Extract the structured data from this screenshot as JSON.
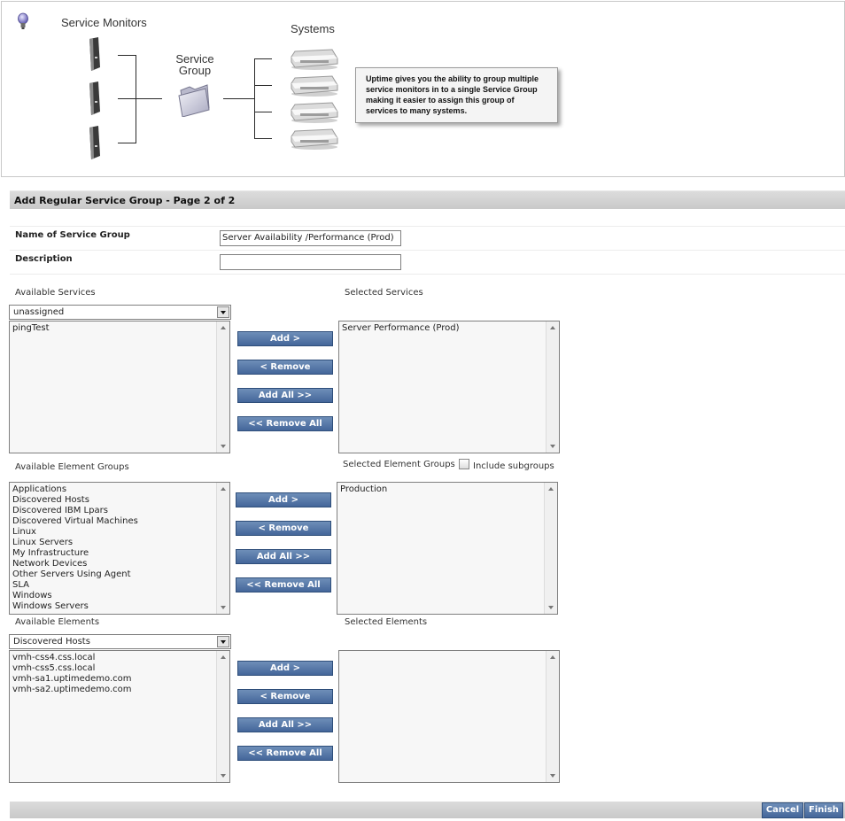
{
  "diagram": {
    "service_monitors_label": "Service Monitors",
    "service_group_label_line1": "Service",
    "service_group_label_line2": "Group",
    "systems_label": "Systems",
    "tooltip_text": "Uptime gives you the ability to group multiple service monitors in to a single Service Group making it easier to assign this group of services to many systems."
  },
  "form": {
    "title": "Add Regular Service Group - Page 2 of 2",
    "name_label": "Name of Service Group",
    "name_value": "Server Availability /Performance (Prod)",
    "description_label": "Description",
    "description_value": ""
  },
  "services": {
    "available_label": "Available Services",
    "selected_label": "Selected Services",
    "filter_value": "unassigned",
    "available_items": [
      "pingTest"
    ],
    "selected_items": [
      "Server Performance (Prod)"
    ]
  },
  "element_groups": {
    "available_label": "Available Element Groups",
    "selected_label": "Selected Element Groups",
    "include_subgroups_label": "Include subgroups",
    "include_subgroups_checked": false,
    "available_items": [
      "Applications",
      "Discovered Hosts",
      "Discovered IBM Lpars",
      "Discovered Virtual Machines",
      "Linux",
      "Linux Servers",
      "My Infrastructure",
      "Network Devices",
      "Other Servers Using Agent",
      "SLA",
      "Windows",
      "Windows Servers"
    ],
    "selected_items": [
      "Production"
    ]
  },
  "elements": {
    "available_label": "Available Elements",
    "selected_label": "Selected Elements",
    "filter_value": "Discovered Hosts",
    "available_items": [
      "vmh-css4.css.local",
      "vmh-css5.css.local",
      "vmh-sa1.uptimedemo.com",
      "vmh-sa2.uptimedemo.com"
    ],
    "selected_items": []
  },
  "buttons": {
    "add": "Add >",
    "remove": "< Remove",
    "add_all": "Add All >>",
    "remove_all": "<< Remove All",
    "cancel": "Cancel",
    "finish": "Finish"
  },
  "icons": {
    "hint": "lightbulb-icon",
    "monitor": "server-tower-icon",
    "group": "folder-icon",
    "system": "server-drive-icon"
  }
}
